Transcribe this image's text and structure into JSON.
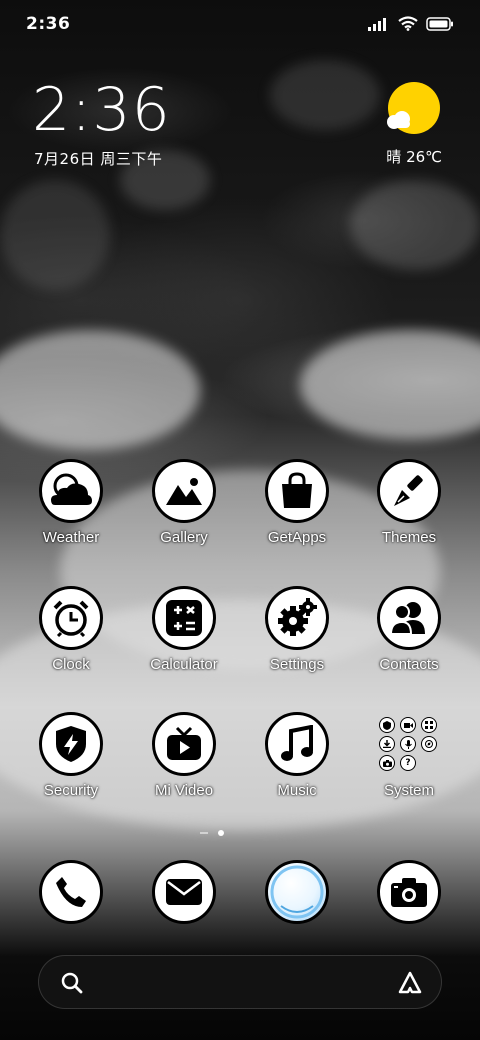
{
  "status_bar": {
    "time": "2:36",
    "icons": [
      "signal-icon",
      "wifi-icon",
      "battery-icon"
    ]
  },
  "clock_widget": {
    "time": "2:36",
    "date": "7月26日 周三下午"
  },
  "weather_widget": {
    "condition_temp": "晴 26℃",
    "icon": "sun-cloud-icon",
    "sun_color": "#FFD200"
  },
  "apps": [
    {
      "label": "Weather",
      "icon": "weather-cloud-icon"
    },
    {
      "label": "Gallery",
      "icon": "gallery-mountain-icon"
    },
    {
      "label": "GetApps",
      "icon": "shopping-bag-icon"
    },
    {
      "label": "Themes",
      "icon": "brush-icon"
    },
    {
      "label": "Clock",
      "icon": "alarm-clock-icon"
    },
    {
      "label": "Calculator",
      "icon": "calculator-icon"
    },
    {
      "label": "Settings",
      "icon": "gears-icon"
    },
    {
      "label": "Contacts",
      "icon": "contacts-icon"
    },
    {
      "label": "Security",
      "icon": "shield-bolt-icon"
    },
    {
      "label": "Mi Video",
      "icon": "tv-play-icon"
    },
    {
      "label": "Music",
      "icon": "music-note-icon"
    },
    {
      "label": "System",
      "icon": "folder-icon"
    }
  ],
  "folder_preview_icons": [
    "shield-mini-icon",
    "video-mini-icon",
    "scan-mini-icon",
    "download-mini-icon",
    "mic-mini-icon",
    "compass-mini-icon",
    "camera-mini-icon",
    "help-mini-icon"
  ],
  "pager": {
    "pages": 2,
    "current": 2
  },
  "dock": [
    {
      "icon": "phone-icon"
    },
    {
      "icon": "mail-icon"
    },
    {
      "icon": "browser-icon"
    },
    {
      "icon": "camera-icon"
    }
  ],
  "search": {
    "icon": "search-icon",
    "assistant_icon": "assistant-icon"
  }
}
